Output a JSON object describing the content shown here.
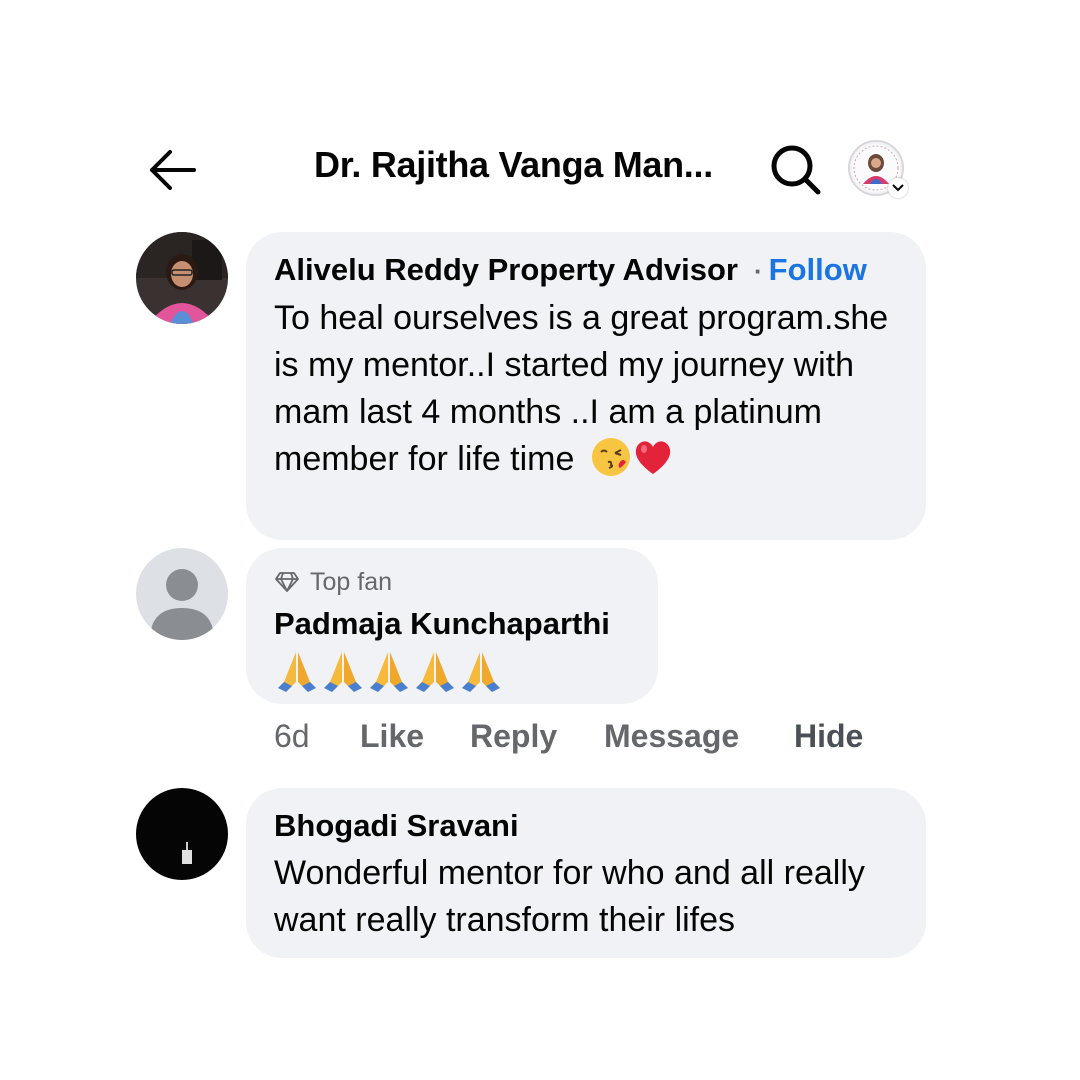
{
  "header": {
    "title": "Dr. Rajitha Vanga Man...",
    "back_icon": "arrow-left-icon",
    "search_icon": "search-icon"
  },
  "comments": [
    {
      "author": "Alivelu Reddy Property Advisor",
      "follow_label": "Follow",
      "separator": "·",
      "text": "To heal ourselves is a great program.she is my mentor..I started my journey with mam last 4 months ..I am a platinum member for life time",
      "emojis": [
        "kissing-face-emoji",
        "red-heart-emoji"
      ]
    },
    {
      "badge": "Top fan",
      "author": "Padmaja Kunchaparthi",
      "emojis": [
        "folded-hands-emoji",
        "folded-hands-emoji",
        "folded-hands-emoji",
        "folded-hands-emoji",
        "folded-hands-emoji"
      ],
      "actions": {
        "time": "6d",
        "like": "Like",
        "reply": "Reply",
        "message": "Message",
        "hide": "Hide"
      }
    },
    {
      "author": "Bhogadi Sravani",
      "text": "Wonderful mentor for who and all really want really transform their lifes"
    }
  ],
  "colors": {
    "bubble": "#f0f2f5",
    "link_blue": "#1b74e4",
    "secondary_text": "#65676b"
  }
}
